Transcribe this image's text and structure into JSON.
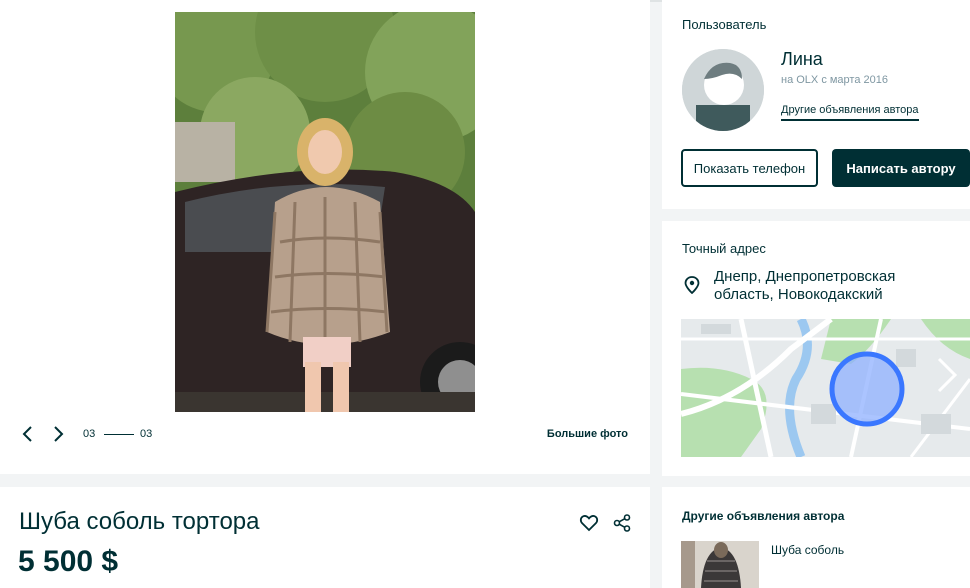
{
  "gallery": {
    "counter_current": "03",
    "counter_total": "03",
    "big_photo_label": "Большие фото"
  },
  "user": {
    "section_title": "Пользователь",
    "name": "Лина",
    "since": "на OLX с марта 2016",
    "other_ads_link": "Другие объявления автора",
    "show_phone_label": "Показать телефон",
    "write_author_label": "Написать автору"
  },
  "address": {
    "section_title": "Точный адрес",
    "location": "Днепр, Днепропетровская область, Новокодакский"
  },
  "ad": {
    "title": "Шуба соболь тортора",
    "price": "5 500 $"
  },
  "other_ads": {
    "section_title": "Другие объявления автора",
    "items": [
      {
        "title": "Шуба соболь"
      }
    ]
  },
  "colors": {
    "brand_dark": "#002f34",
    "muted": "#7f97a2",
    "map_circle": "#3a77ff"
  },
  "icons": [
    "chevron-left-icon",
    "chevron-right-icon",
    "map-pin-icon",
    "heart-icon",
    "share-icon"
  ]
}
